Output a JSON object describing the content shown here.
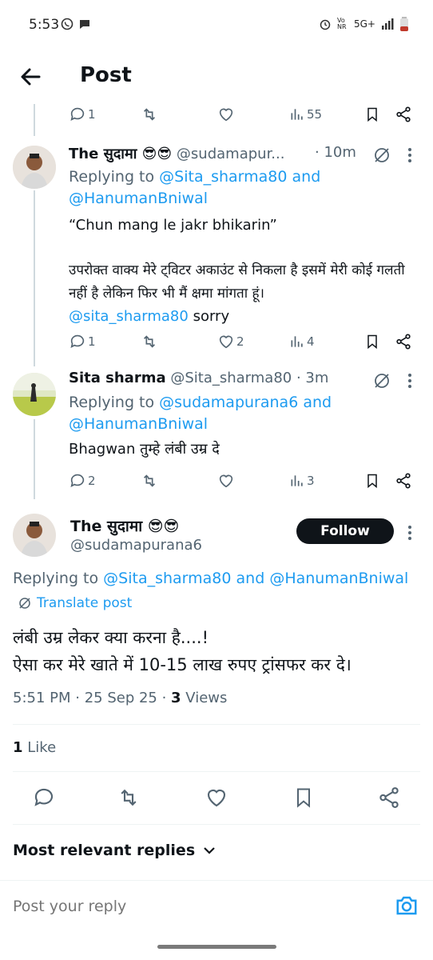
{
  "status_bar": {
    "time": "5:53",
    "network": "5G+",
    "vo_label": "Vo NR"
  },
  "header": {
    "title": "Post"
  },
  "top_tweet_actions": {
    "replies": "1",
    "retweets": "",
    "likes": "",
    "views": "55"
  },
  "replies": [
    {
      "name": "The सुदामा 😎😎",
      "handle": "@sudamapur...",
      "time": "· 10m",
      "replying_prefix": "Replying to ",
      "replying_to_1": "@Sita_sharma80",
      "replying_and": " and",
      "replying_to_2": "@HanumanBniwal",
      "text_line1": "“Chun mang le jakr bhikarin”",
      "text_line2": "उपरोक्त वाक्य मेरे ट्विटर अकाउंट से निकला है इसमें मेरी कोई गलती नहीं है लेकिन फिर भी मैं क्षमा मांगता हूं।",
      "text_mention": "@sita_sharma80",
      "text_tail": " sorry",
      "replies": "1",
      "likes": "2",
      "views": "4"
    },
    {
      "name": "Sita sharma",
      "handle": "@Sita_sharma80",
      "time": "· 3m",
      "replying_prefix": "Replying to ",
      "replying_to_1": "@sudamapurana6",
      "replying_and": " and",
      "replying_to_2": "@HanumanBniwal",
      "text_line1": "Bhagwan तुम्हे लंबी उम्र दे",
      "replies": "2",
      "likes": "",
      "views": "3"
    }
  ],
  "main_post": {
    "name": "The सुदामा 😎😎",
    "handle": "@sudamapurana6",
    "follow_label": "Follow",
    "replying_prefix": "Replying to ",
    "replying_to_1": "@Sita_sharma80",
    "replying_and": " and ",
    "replying_to_2": "@HanumanBniwal",
    "translate_label": "Translate post",
    "text_line1": "लंबी उम्र लेकर क्या करना है....!",
    "text_line2": "ऐसा कर मेरे खाते में 10-15 लाख रुपए ट्रांसफर कर दे।",
    "timestamp": "5:51 PM · 25 Sep 25 · ",
    "views_count": "3",
    "views_label": " Views",
    "likes_count": "1",
    "likes_label": " Like"
  },
  "replies_filter": {
    "label": "Most relevant replies"
  },
  "reply_box": {
    "placeholder": "Post your reply"
  },
  "colors": {
    "accent": "#1d9bf0",
    "text": "#0f1419",
    "muted": "#536471"
  }
}
